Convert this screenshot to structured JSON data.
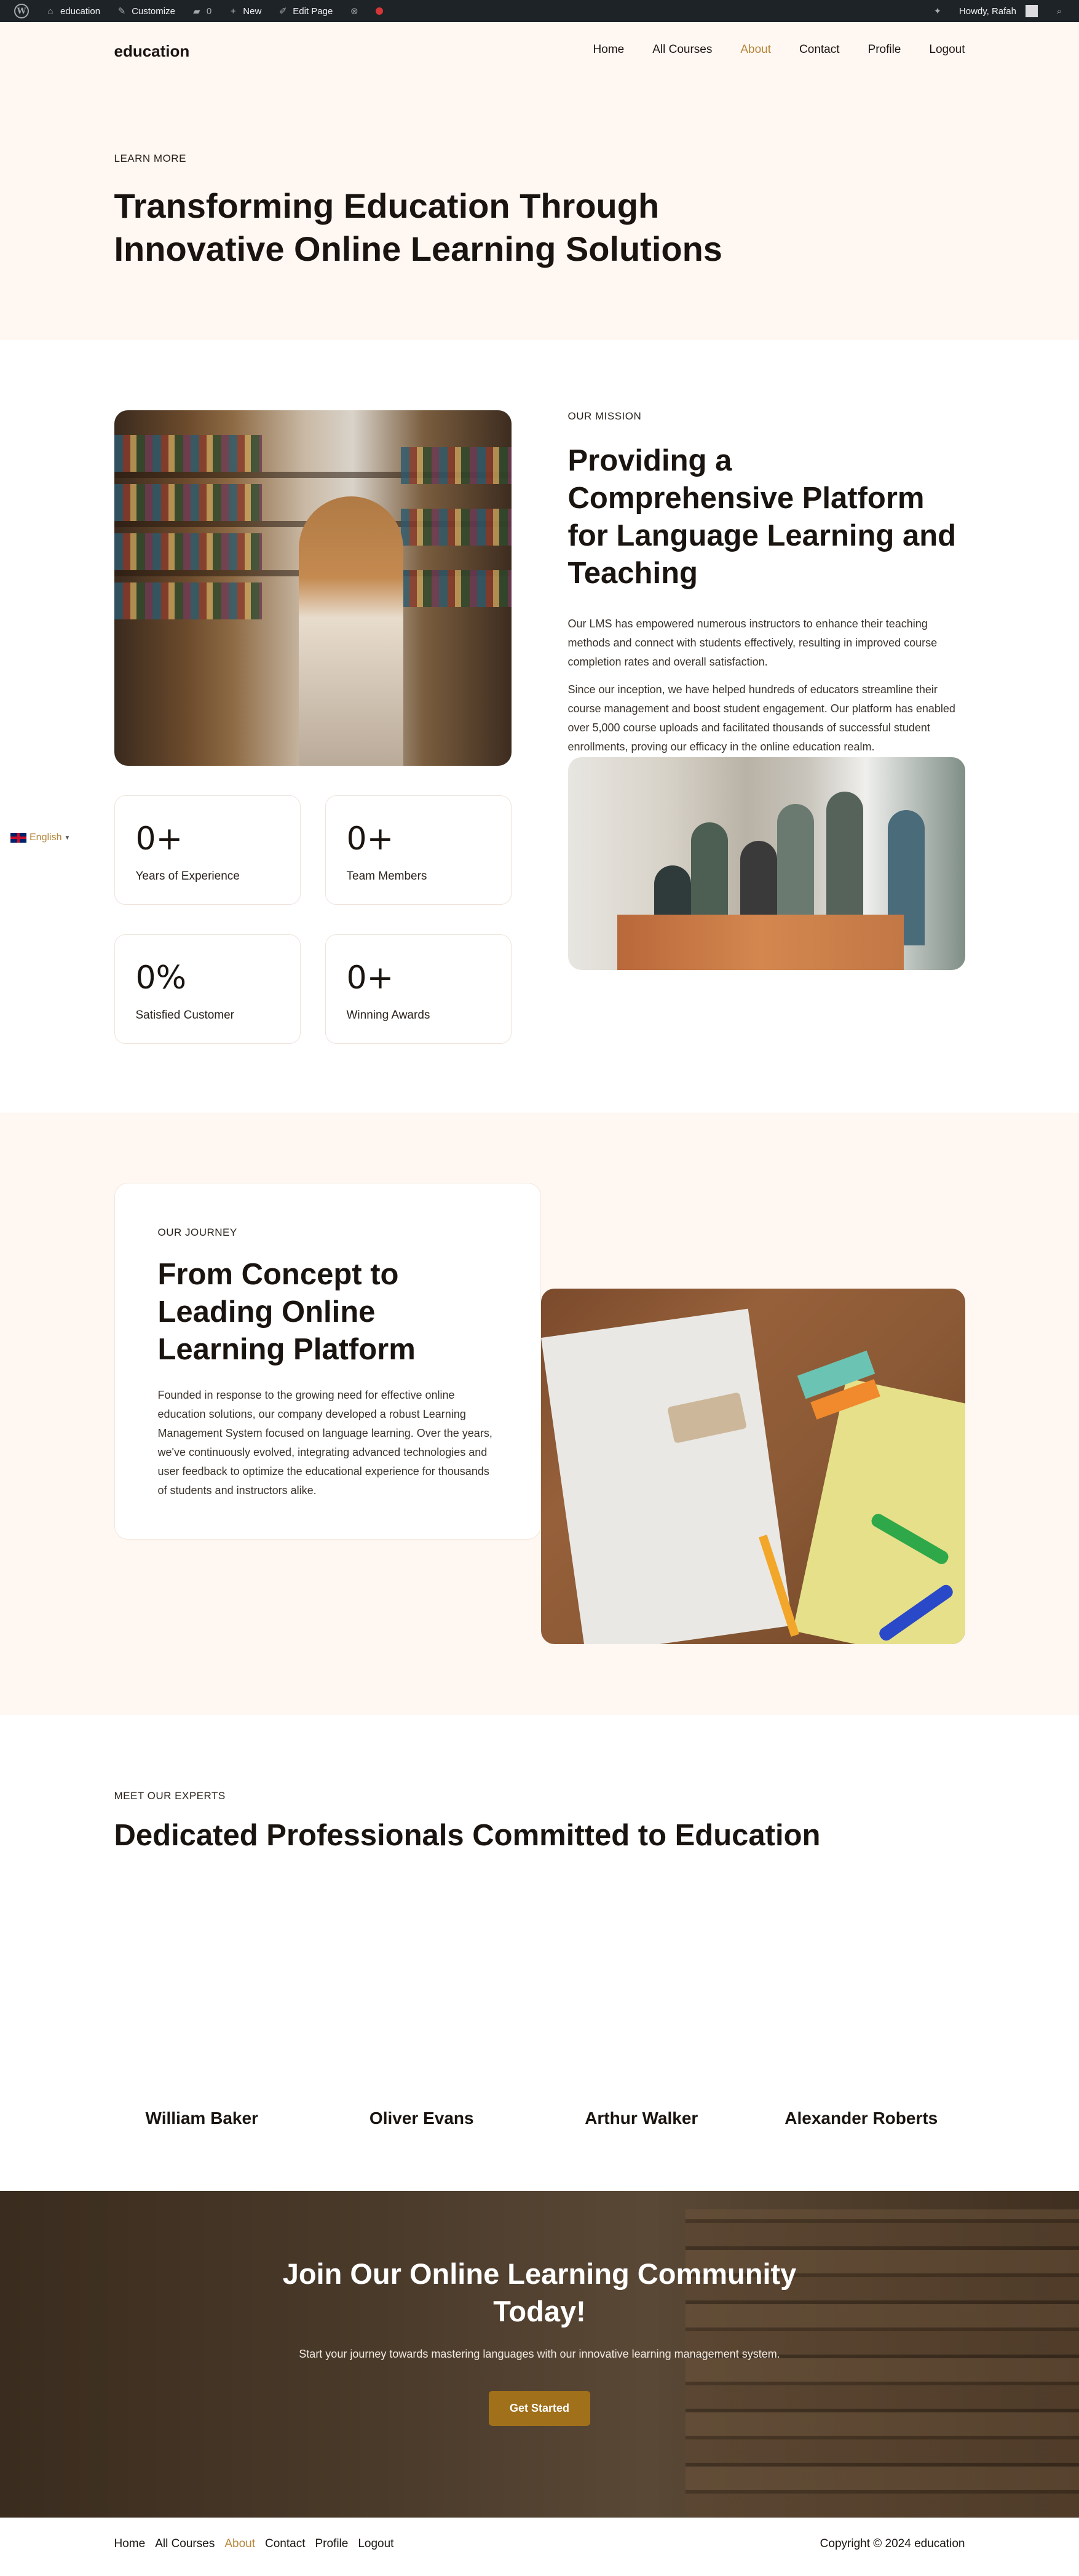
{
  "adminbar": {
    "site_name": "education",
    "customize": "Customize",
    "comments_count": "0",
    "new": "New",
    "edit_page": "Edit Page",
    "howdy": "Howdy, Rafah"
  },
  "header": {
    "logo": "education",
    "nav": [
      {
        "label": "Home"
      },
      {
        "label": "All Courses"
      },
      {
        "label": "About",
        "active": true
      },
      {
        "label": "Contact"
      },
      {
        "label": "Profile"
      },
      {
        "label": "Logout"
      }
    ]
  },
  "hero": {
    "eyebrow": "LEARN MORE",
    "title": "Transforming Education Through Innovative Online Learning Solutions"
  },
  "language": {
    "label": "English"
  },
  "mission": {
    "eyebrow": "OUR MISSION",
    "title": "Providing a Comprehensive Platform for Language Learning and Teaching",
    "paragraphs": [
      "Our LMS has empowered numerous instructors to enhance their teaching methods and connect with students effectively, resulting in improved course completion rates and overall satisfaction.",
      "Since our inception, we have helped hundreds of educators streamline their course management and boost student engagement. Our platform has enabled over 5,000 course uploads and facilitated thousands of successful student enrollments, proving our efficacy in the online education realm."
    ],
    "stats": [
      {
        "value": "0+",
        "label": "Years of Experience"
      },
      {
        "value": "0+",
        "label": "Team Members"
      },
      {
        "value": "0%",
        "label": "Satisfied Customer"
      },
      {
        "value": "0+",
        "label": "Winning Awards"
      }
    ]
  },
  "journey": {
    "eyebrow": "OUR JOURNEY",
    "title": "From Concept to Leading Online Learning Platform",
    "text": "Founded in response to the growing need for effective online education solutions, our company developed a robust Learning Management System focused on language learning. Over the years, we've continuously evolved, integrating advanced technologies and user feedback to optimize the educational experience for thousands of students and instructors alike."
  },
  "experts": {
    "eyebrow": "MEET OUR EXPERTS",
    "title": "Dedicated Professionals Committed to Education",
    "members": [
      {
        "name": "William Baker"
      },
      {
        "name": "Oliver Evans"
      },
      {
        "name": "Arthur Walker"
      },
      {
        "name": "Alexander Roberts"
      }
    ]
  },
  "cta": {
    "title": "Join Our Online Learning Community Today!",
    "text": "Start your journey towards mastering languages with our innovative learning management system.",
    "button": "Get Started"
  },
  "footer": {
    "nav": [
      {
        "label": "Home"
      },
      {
        "label": "All Courses"
      },
      {
        "label": "About",
        "active": true
      },
      {
        "label": "Contact"
      },
      {
        "label": "Profile"
      },
      {
        "label": "Logout"
      }
    ],
    "copyright": "Copyright © 2024 education"
  },
  "colors": {
    "accent": "#b5863a",
    "button": "#a0701a",
    "cream_bg": "#fff7f2",
    "admin_bar": "#1d2327"
  }
}
